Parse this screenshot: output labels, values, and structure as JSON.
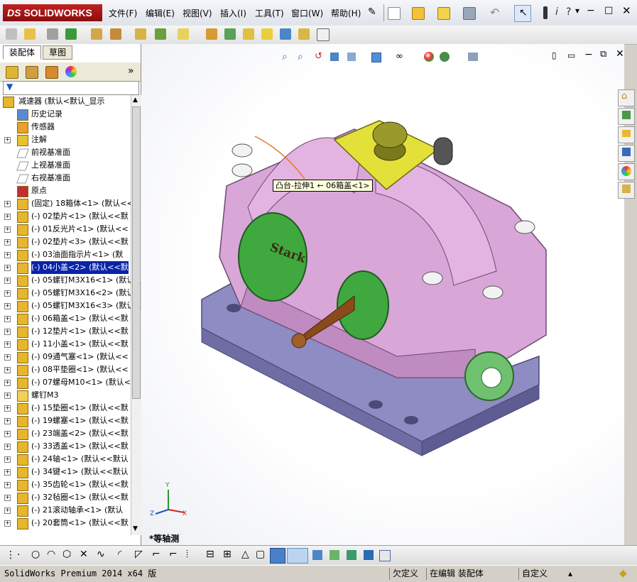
{
  "app": {
    "logo_prefix": "DS",
    "logo_text": "SOLIDWORKS"
  },
  "menu": [
    "文件(F)",
    "编辑(E)",
    "视图(V)",
    "插入(I)",
    "工具(T)",
    "窗口(W)",
    "帮助(H)"
  ],
  "panel": {
    "tabs": [
      "装配体",
      "草图"
    ],
    "active_tab": "装配体",
    "tree": [
      {
        "label": "减速器  (默认<默认_显示",
        "icon": "assembly-icon",
        "level": 0,
        "expand": "-"
      },
      {
        "label": "历史记录",
        "icon": "history-icon",
        "level": 1,
        "expand": ""
      },
      {
        "label": "传感器",
        "icon": "sensor-icon",
        "level": 1,
        "expand": ""
      },
      {
        "label": "注解",
        "icon": "annotation-icon",
        "level": 1,
        "expand": "+"
      },
      {
        "label": "前视基准面",
        "icon": "plane-icon",
        "level": 1,
        "expand": ""
      },
      {
        "label": "上视基准面",
        "icon": "plane-icon",
        "level": 1,
        "expand": ""
      },
      {
        "label": "右视基准面",
        "icon": "plane-icon",
        "level": 1,
        "expand": ""
      },
      {
        "label": "原点",
        "icon": "origin-icon",
        "level": 1,
        "expand": ""
      },
      {
        "label": "(固定) 18箱体<1> (默认<<",
        "icon": "part-icon",
        "level": 1,
        "expand": "+"
      },
      {
        "label": "(-) 02垫片<1> (默认<<默",
        "icon": "part-icon",
        "level": 1,
        "expand": "+"
      },
      {
        "label": "(-) 01反光片<1> (默认<<",
        "icon": "part-icon",
        "level": 1,
        "expand": "+"
      },
      {
        "label": "(-) 02垫片<3> (默认<<默",
        "icon": "part-icon",
        "level": 1,
        "expand": "+"
      },
      {
        "label": "(-) 03油面指示片<1> (默",
        "icon": "part-icon",
        "level": 1,
        "expand": "+"
      },
      {
        "label": "(-) 04小盖<2> (默认<<默",
        "icon": "part-icon",
        "level": 1,
        "expand": "+",
        "selected": true
      },
      {
        "label": "(-) 05螺钉M3X16<1> (默认",
        "icon": "part-icon",
        "level": 1,
        "expand": "+"
      },
      {
        "label": "(-) 05螺钉M3X16<2> (默认",
        "icon": "part-icon",
        "level": 1,
        "expand": "+"
      },
      {
        "label": "(-) 05螺钉M3X16<3> (默认",
        "icon": "part-icon",
        "level": 1,
        "expand": "+"
      },
      {
        "label": "(-) 06箱盖<1> (默认<<默",
        "icon": "part-icon",
        "level": 1,
        "expand": "+"
      },
      {
        "label": "(-) 12垫片<1> (默认<<默",
        "icon": "part-icon",
        "level": 1,
        "expand": "+"
      },
      {
        "label": "(-) 11小盖<1> (默认<<默",
        "icon": "part-icon",
        "level": 1,
        "expand": "+"
      },
      {
        "label": "(-) 09通气塞<1> (默认<<",
        "icon": "part-icon",
        "level": 1,
        "expand": "+"
      },
      {
        "label": "(-) 08平垫圈<1> (默认<<",
        "icon": "part-icon",
        "level": 1,
        "expand": "+"
      },
      {
        "label": "(-) 07螺母M10<1> (默认<",
        "icon": "part-icon",
        "level": 1,
        "expand": "+"
      },
      {
        "label": "螺钉M3",
        "icon": "folder-icon",
        "level": 1,
        "expand": "+"
      },
      {
        "label": "(-) 15垫圈<1> (默认<<默",
        "icon": "part-icon",
        "level": 1,
        "expand": "+"
      },
      {
        "label": "(-) 19螺塞<1> (默认<<默",
        "icon": "part-icon",
        "level": 1,
        "expand": "+"
      },
      {
        "label": "(-) 23端盖<2> (默认<<默",
        "icon": "part-icon",
        "level": 1,
        "expand": "+"
      },
      {
        "label": "(-) 33透盖<1> (默认<<默",
        "icon": "part-icon",
        "level": 1,
        "expand": "+"
      },
      {
        "label": "(-) 24轴<1> (默认<<默认",
        "icon": "part-icon",
        "level": 1,
        "expand": "+"
      },
      {
        "label": "(-) 34键<1> (默认<<默认",
        "icon": "part-icon",
        "level": 1,
        "expand": "+"
      },
      {
        "label": "(-) 35齿轮<1> (默认<<默",
        "icon": "part-icon",
        "level": 1,
        "expand": "+"
      },
      {
        "label": "(-) 32毡圈<1> (默认<<默",
        "icon": "part-icon",
        "level": 1,
        "expand": "+"
      },
      {
        "label": "(-) 21滚动轴承<1> (默认",
        "icon": "part-icon",
        "level": 1,
        "expand": "+"
      },
      {
        "label": "(-) 20套筒<1> (默认<<默",
        "icon": "part-icon",
        "level": 1,
        "expand": "+"
      }
    ]
  },
  "viewport": {
    "tooltip": "凸台-拉伸1  ←  06箱盖<1>",
    "model_label": "Stark",
    "view_name": "*等轴测",
    "triad": {
      "x": "X",
      "y": "Y",
      "z": "Z"
    }
  },
  "status": {
    "version": "SolidWorks Premium 2014 x64 版",
    "defined": "欠定义",
    "mode": "在编辑 装配体",
    "custom": "自定义"
  },
  "colors": {
    "accent_red": "#b01818",
    "selection": "#0a24a8",
    "housing_pink": "#d9a6d8",
    "base_lavender": "#8e8cc2",
    "cover_green": "#3fa93f"
  }
}
